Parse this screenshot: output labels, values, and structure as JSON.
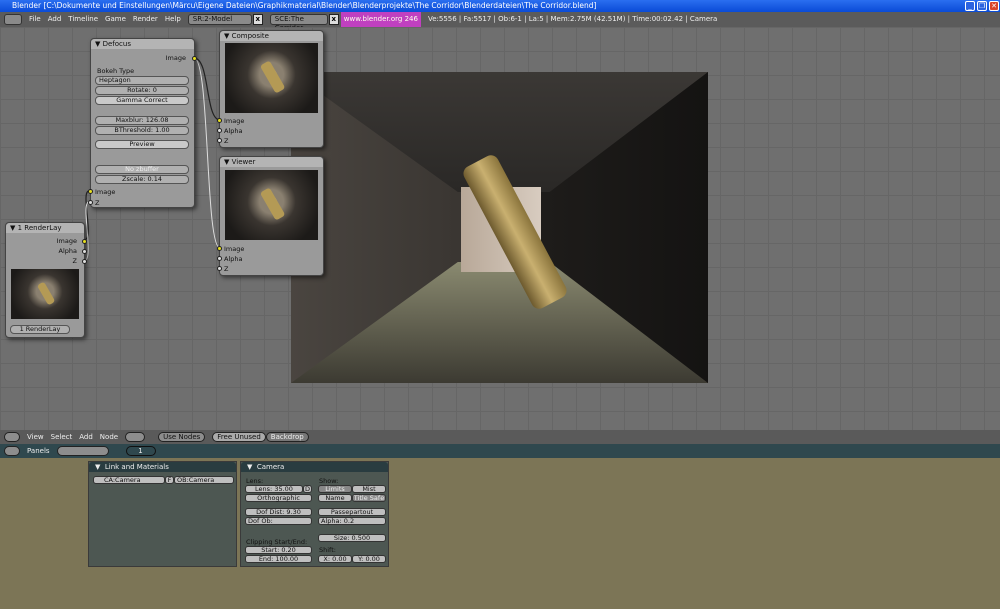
{
  "window": {
    "title": "Blender [C:\\Dokumente und Einstellungen\\Märcu\\Eigene Dateien\\Graphikmaterial\\Blender\\Blenderprojekte\\The Corridor\\Blenderdateien\\The Corridor.blend]",
    "minimize": "_",
    "restore": "❐",
    "close": "✕"
  },
  "menubar": {
    "items": [
      "File",
      "Add",
      "Timeline",
      "Game",
      "Render",
      "Help"
    ],
    "screen": "SR:2-Model",
    "scene": "SCE:The Corridor",
    "url": "www.blender.org 246",
    "stats": "Ve:5556 | Fa:5517 | Ob:6-1 | La:5  | Mem:2.75M (42.51M) | Time:00:02.42 | Camera"
  },
  "nodes": {
    "defocus": {
      "title": "Defocus",
      "out_image": "Image",
      "bokeh_label": "Bokeh Type",
      "bokeh_value": "Heptagon",
      "rotate": "Rotate: 0",
      "gamma": "Gamma Correct",
      "maxblur": "Maxblur: 126.08",
      "bthreshold": "BThreshold: 1.00",
      "preview": "Preview",
      "nozbuffer": "No zbuffer",
      "zscale": "Zscale: 0.14",
      "in_image": "Image",
      "in_z": "Z"
    },
    "composite": {
      "title": "Composite",
      "in": [
        "Image",
        "Alpha",
        "Z"
      ]
    },
    "viewer": {
      "title": "Viewer",
      "in": [
        "Image",
        "Alpha",
        "Z"
      ]
    },
    "renderlayer": {
      "title": "1 RenderLay",
      "out": [
        "Image",
        "Alpha",
        "Z"
      ],
      "layer": "1 RenderLay"
    }
  },
  "node_header": {
    "menus": [
      "View",
      "Select",
      "Add",
      "Node"
    ],
    "use_nodes": "Use Nodes",
    "free_unused": "Free Unused",
    "backdrop": "Backdrop"
  },
  "panels_header": {
    "label": "Panels",
    "page": "1"
  },
  "link_materials": {
    "title": "Link and Materials",
    "camera_data": "CA:Camera",
    "fake": "F",
    "object": "OB:Camera"
  },
  "camera": {
    "title": "Camera",
    "lens_label": "Lens:",
    "lens": "Lens: 35.00",
    "d": "D",
    "orthographic": "Orthographic",
    "show_label": "Show:",
    "limits": "Limits",
    "mist": "Mist",
    "name": "Name",
    "title_safe": "Title Safe",
    "dof_dist": "Dof Dist: 9.30",
    "dof_ob": "Dof Ob:",
    "passepartout": "Passepartout",
    "alpha": "Alpha: 0.2",
    "size": "Size: 0.500",
    "clipping_label": "Clipping Start/End:",
    "start": "Start: 0.20",
    "end": "End: 100.00",
    "shift_label": "Shift:",
    "shift_x": "X: 0.00",
    "shift_y": "Y: 0.00"
  }
}
